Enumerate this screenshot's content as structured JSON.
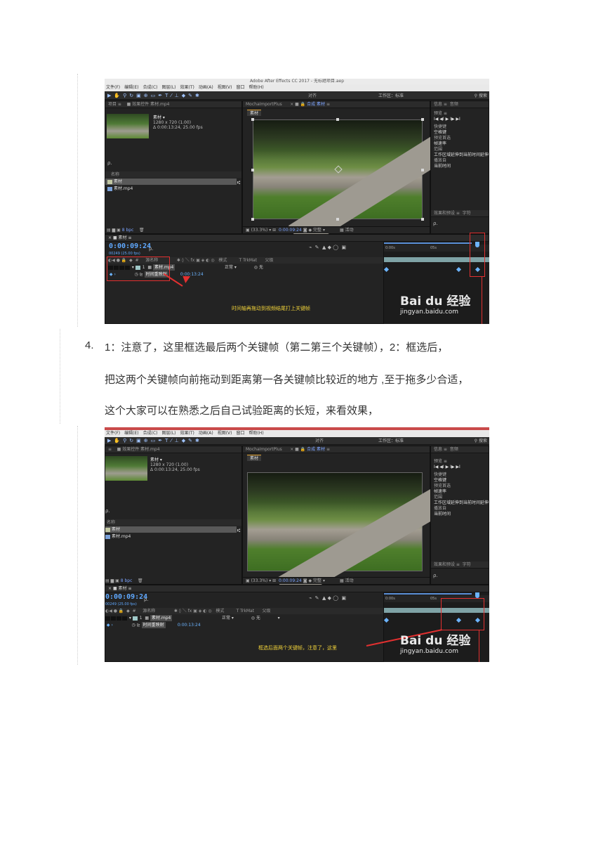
{
  "screenshot1": {
    "title_fragment": "Adobe After Effects CC 2017 - 无标题项目.aep",
    "menu": [
      "文件(F)",
      "编辑(E)",
      "合成(C)",
      "图层(L)",
      "效果(T)",
      "动画(A)",
      "视图(V)",
      "窗口",
      "帮助(H)"
    ],
    "toolbar": {
      "align": "对齐",
      "workspace_label": "工作区：",
      "workspace_value": "标准",
      "search": "搜索"
    },
    "project_panel": {
      "tab": "项目",
      "effects_tab": "效果控件 素材.mp4",
      "item_name": "素材 ▾",
      "item_res": "1280 x 720 (1.00)",
      "item_dur": "Δ 0:00:13:24, 25.00 fps",
      "search": "ρ.",
      "col_name": "名称",
      "items": [
        "素材",
        "素材.mp4"
      ],
      "bpc": "8 bpc"
    },
    "viewer": {
      "tab1": "MochaImportPlus",
      "tab2": "合成 素材",
      "comp_tab": "素材",
      "zoom": "(33.3%)",
      "time": "0:00:09:24",
      "quality": "完整",
      "active": "活动"
    },
    "right_panel": {
      "tab": "信息",
      "tab2": "音频",
      "preview": "预览",
      "controls": "I◀ ◀I ▶ I▶ ▶I",
      "items": [
        "快捷键",
        "空格键",
        "预览首选",
        "帧速率",
        "范围",
        "工作区域延伸到当前时间延伸",
        "播放自",
        "当前时间"
      ],
      "effects": "效果和预设",
      "char": "字符",
      "search": "ρ."
    },
    "timeline": {
      "tab": "素材",
      "timecode": "0:00:09:24",
      "timecode_sub": "00249 (25.00 fps)",
      "search": "ρ.",
      "cols": {
        "src": "源名称",
        "mode": "模式",
        "trk": "T  TrkMat",
        "parent": "父级"
      },
      "layer_num": "1",
      "layer_name": "素材.mp4",
      "mode_value": "正常",
      "parent_value": "无",
      "prop": "时间重映射",
      "prop_value": "0:00:13:24",
      "ruler_start": "0:00s",
      "ruler_mid": "05s"
    },
    "annotation": "时间轴再拖动到视频结尾打上关键帧",
    "watermark": {
      "brand": "Bai du 经验",
      "url": "jingyan.baidu.com"
    }
  },
  "step4": {
    "number": "4.",
    "line1": "1：注意了，这里框选最后两个关键帧（第二第三个关键帧），2：框选后，",
    "line2": "把这两个关键帧向前拖动到距离第一各关键帧比较近的地方 ,至于拖多少合适，",
    "line3": "这个大家可以在熟悉之后自己试验距离的长短，来看效果，"
  },
  "screenshot2": {
    "menu": [
      "文件(F)",
      "编辑(E)",
      "合成(C)",
      "图层(L)",
      "效果(T)",
      "动画(A)",
      "视图(V)",
      "窗口",
      "帮助(H)"
    ],
    "toolbar": {
      "align": "对齐",
      "workspace_label": "工作区：",
      "workspace_value": "标准",
      "search": "搜索"
    },
    "project_panel": {
      "effects_tab": "效果控件 素材.mp4",
      "item_name": "素材 ▾",
      "item_res": "1280 x 720 (1.00)",
      "item_dur": "Δ 0:00:13:24, 25.00 fps",
      "search": "ρ.",
      "col_name": "名称",
      "items": [
        "素材",
        "素材.mp4"
      ],
      "bpc": "8 bpc"
    },
    "viewer": {
      "tab1": "MochaImportPlus",
      "tab2": "合成 素材",
      "comp_tab": "素材",
      "zoom": "(33.3%)",
      "time": "0:00:09:24",
      "quality": "完整",
      "active": "活动"
    },
    "right_panel": {
      "tab": "信息",
      "tab2": "音频",
      "preview": "预览",
      "controls": "I◀ ◀I ▶ I▶ ▶I",
      "items": [
        "快捷键",
        "空格键",
        "预览首选",
        "帧速率",
        "范围",
        "工作区域延伸到当前时间延伸",
        "播放自",
        "当前时间"
      ],
      "effects": "效果和预设",
      "char": "字符",
      "search": "ρ."
    },
    "timeline": {
      "tab": "素材",
      "timecode": "0:00:09:24",
      "timecode_sub": "00249 (25.00 fps)",
      "search": "ρ.",
      "cols": {
        "src": "源名称",
        "mode": "模式",
        "trk": "T  TrkMat",
        "parent": "父级"
      },
      "layer_num": "1",
      "layer_name": "素材.mp4",
      "mode_value": "正常",
      "parent_value": "无",
      "prop": "时间重映射",
      "prop_value": "0:00:13:24",
      "ruler_start": "0:00s",
      "ruler_mid": "05s"
    },
    "annotation": "框选后面两个关键帧，注意了，这里",
    "watermark": {
      "brand": "Bai du 经验",
      "url": "jingyan.baidu.com"
    }
  }
}
